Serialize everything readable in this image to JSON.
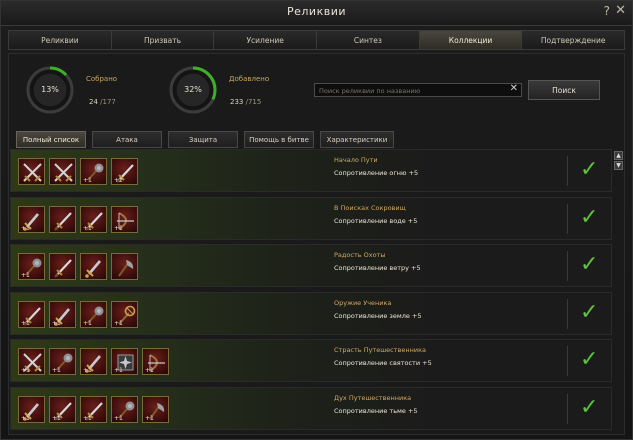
{
  "window": {
    "title": "Реликвии",
    "help": "?",
    "close": "✕"
  },
  "tabs": [
    {
      "label": "Реликвии"
    },
    {
      "label": "Призвать"
    },
    {
      "label": "Усиление"
    },
    {
      "label": "Синтез"
    },
    {
      "label": "Коллекции"
    },
    {
      "label": "Подтверждение"
    }
  ],
  "active_tab": 4,
  "stats": {
    "collected": {
      "percent_text": "13%",
      "percent": 0.13,
      "label": "Собрано",
      "count": "24",
      "total": " /177"
    },
    "added": {
      "percent_text": "32%",
      "percent": 0.32,
      "label": "Добавлено",
      "count": "233",
      "total": " /715"
    }
  },
  "search": {
    "placeholder": "Поиск реликвии по названию",
    "value": "",
    "clear": "✕",
    "button": "Поиск"
  },
  "filters": [
    {
      "label": "Полный список"
    },
    {
      "label": "Атака"
    },
    {
      "label": "Защита"
    },
    {
      "label": "Помощь в битве"
    },
    {
      "label": "Характеристики"
    }
  ],
  "active_filter": 0,
  "collections": [
    {
      "name": "Начало Пути",
      "bonus": "Сопротивление огню +5",
      "items": [
        {
          "icon": "crossed-swords-icon",
          "plus": ""
        },
        {
          "icon": "crossed-swords-icon",
          "plus": ""
        },
        {
          "icon": "mace-icon",
          "plus": "+1"
        },
        {
          "icon": "sword-icon",
          "plus": "+2"
        }
      ]
    },
    {
      "name": "В Поисках Сокровищ",
      "bonus": "Сопротивление воде +5",
      "items": [
        {
          "icon": "dagger-icon",
          "plus": "+1"
        },
        {
          "icon": "sword-icon",
          "plus": ""
        },
        {
          "icon": "sword-icon",
          "plus": "+1"
        },
        {
          "icon": "bow-icon",
          "plus": "+1"
        }
      ]
    },
    {
      "name": "Радость Охоты",
      "bonus": "Сопротивление ветру +5",
      "items": [
        {
          "icon": "mace-icon",
          "plus": "+1"
        },
        {
          "icon": "sword-icon",
          "plus": ""
        },
        {
          "icon": "dagger-icon",
          "plus": ""
        },
        {
          "icon": "axe-icon",
          "plus": ""
        }
      ]
    },
    {
      "name": "Оружие Ученика",
      "bonus": "Сопротивление земле +5",
      "items": [
        {
          "icon": "sword-icon",
          "plus": "+1"
        },
        {
          "icon": "dagger-icon",
          "plus": "+1"
        },
        {
          "icon": "mace-icon",
          "plus": "+1"
        },
        {
          "icon": "staff-icon",
          "plus": "+1"
        }
      ]
    },
    {
      "name": "Страсть Путешественника",
      "bonus": "Сопротивление святости +5",
      "items": [
        {
          "icon": "crossed-swords-icon",
          "plus": "+1"
        },
        {
          "icon": "mace-icon",
          "plus": "+1"
        },
        {
          "icon": "dagger-icon",
          "plus": "+1"
        },
        {
          "icon": "shuriken-icon",
          "plus": "+1"
        },
        {
          "icon": "bow-icon",
          "plus": "+1"
        }
      ]
    },
    {
      "name": "Дух Путешественника",
      "bonus": "Сопротивление тьме +5",
      "items": [
        {
          "icon": "dagger-icon",
          "plus": "+1"
        },
        {
          "icon": "sword-icon",
          "plus": "+1"
        },
        {
          "icon": "sword-icon",
          "plus": "+1"
        },
        {
          "icon": "mace-icon",
          "plus": "+1"
        },
        {
          "icon": "axe-icon",
          "plus": "+1"
        }
      ]
    }
  ],
  "colors": {
    "accent_gold": "#d0a860",
    "check_green": "#5ec23a",
    "gauge_green": "#3fae2a",
    "slot_red": "#6a1f1a"
  }
}
